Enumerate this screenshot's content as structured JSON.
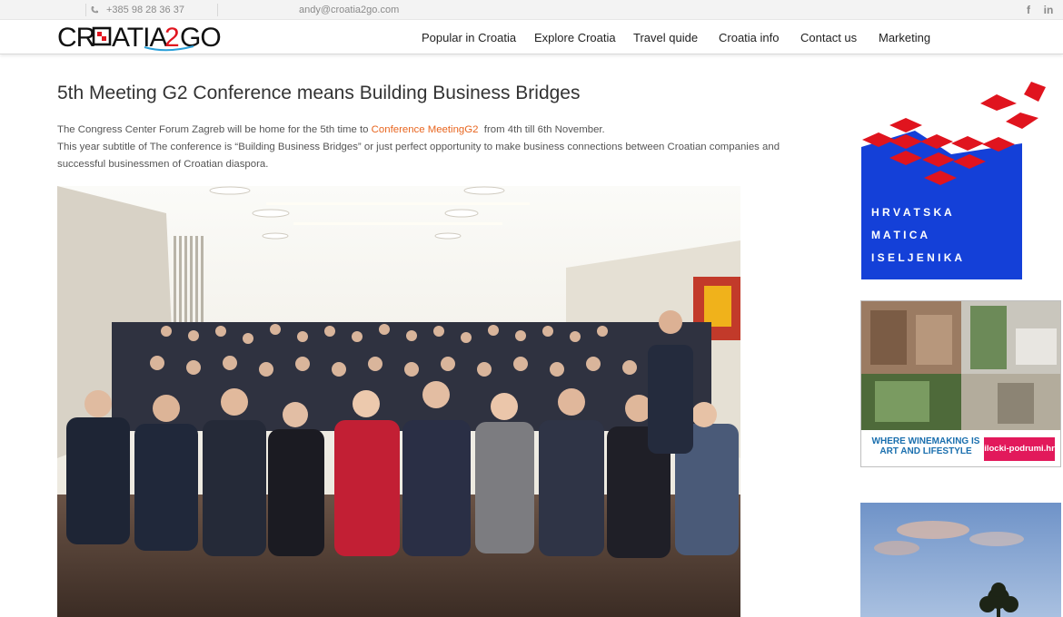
{
  "topbar": {
    "phone": "+385 98 28 36 37",
    "email": "andy@croatia2go.com",
    "social": {
      "facebook": "f",
      "linkedin": "in"
    }
  },
  "header": {
    "logo_text": "CROATIA2GO",
    "nav": [
      {
        "label": "Popular in Croatia"
      },
      {
        "label": "Explore Croatia"
      },
      {
        "label": "Travel quide"
      },
      {
        "label": "Croatia info"
      },
      {
        "label": "Contact us"
      },
      {
        "label": "Marketing"
      }
    ]
  },
  "article": {
    "title": "5th Meeting G2 Conference means Building Business Bridges",
    "para1_pre": "The Congress Center Forum Zagreb will be home for the 5th time to ",
    "para1_link": "Conference MeetingG2",
    "para1_post": "  from 4th till 6th November.",
    "para2": "This year subtitle of The conference is “Building Business Bridges” or just perfect opportunity to make business connections between Croatian companies and successful businessmen of Croatian diaspora."
  },
  "sidebar": {
    "hmi_ad": {
      "lines": [
        "H R V A T S K A",
        "M A T I C A",
        "I S E L J E N I K A"
      ]
    },
    "ilok_ad": {
      "tagline": "WHERE WINEMAKING IS ART AND LIFESTYLE",
      "site": "ilocki-podrumi.hr"
    }
  },
  "colors": {
    "accent": "#e8651f",
    "nav_text": "#222222",
    "hmi_blue": "#1440d8",
    "hmi_red": "#e0141e",
    "ilok_pink": "#e2195b"
  }
}
